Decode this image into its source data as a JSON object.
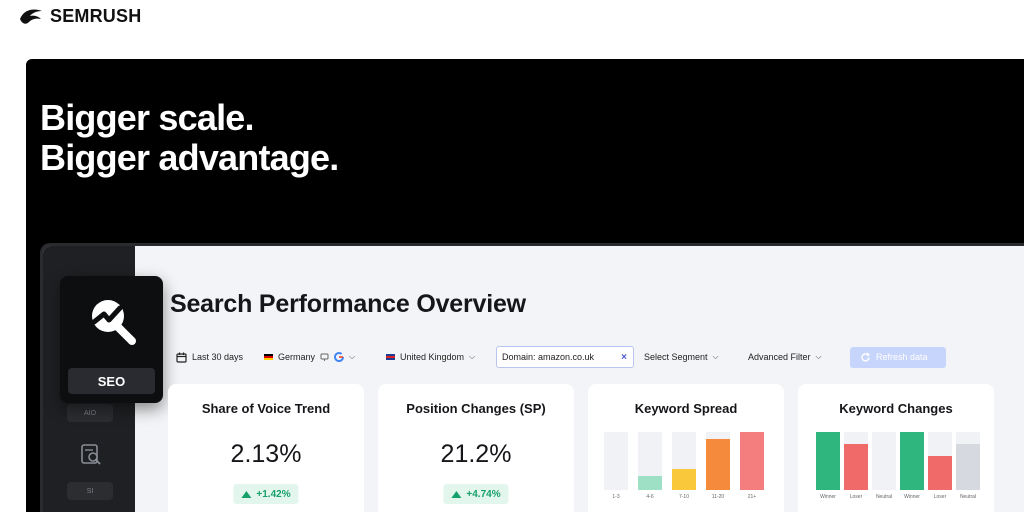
{
  "brand": {
    "name": "SEMRUSH"
  },
  "hero": {
    "line1": "Bigger scale.",
    "line2": "Bigger advantage."
  },
  "product": {
    "badge": "SEO",
    "rail_pill_1": "AIO",
    "rail_pill_2": "SI"
  },
  "page": {
    "title": "Search Performance Overview"
  },
  "filters": {
    "date": "Last 30 days",
    "country": "Germany",
    "location": "United Kingdom",
    "domain": "Domain: amazon.co.uk",
    "segment": "Select Segment",
    "advanced": "Advanced Filter",
    "refresh": "Refresh data"
  },
  "cards": {
    "sov": {
      "title": "Share of Voice Trend",
      "value": "2.13%",
      "delta": "+1.42%"
    },
    "pos": {
      "title": "Position Changes (SP)",
      "value": "21.2%",
      "delta": "+4.74%"
    },
    "spread": {
      "title": "Keyword Spread",
      "bars": [
        {
          "label": "1-3",
          "level": 0,
          "color": "#f1f2f5"
        },
        {
          "label": "4-6",
          "level": 0.24,
          "color": "#9ee0c6"
        },
        {
          "label": "7-10",
          "level": 0.36,
          "color": "#f9c93b"
        },
        {
          "label": "11-20",
          "level": 0.88,
          "color": "#f58a3c"
        },
        {
          "label": "21+",
          "level": 1.0,
          "color": "#f47d7d"
        }
      ]
    },
    "changes": {
      "title": "Keyword Changes",
      "bars": [
        {
          "label": "Winner",
          "level": 1.0,
          "color": "#2fb67e"
        },
        {
          "label": "Loser",
          "level": 0.8,
          "color": "#f06a6a"
        },
        {
          "label": "Neutral",
          "level": 0,
          "color": "#d7d9e0"
        },
        {
          "label": "Winner",
          "level": 1.0,
          "color": "#2fb67e"
        },
        {
          "label": "Loser",
          "level": 0.58,
          "color": "#f06a6a"
        },
        {
          "label": "Neutral",
          "level": 0.8,
          "color": "#d7d9e0"
        }
      ]
    }
  },
  "colors": {
    "accent": "#4a5ad8",
    "positive": "#17a06a",
    "hero_bg": "#000000"
  },
  "icons": {
    "logo": "semrush-flame-icon",
    "calendar": "calendar-icon",
    "google": "google-icon",
    "seo": "seo-magnifier-icon"
  }
}
